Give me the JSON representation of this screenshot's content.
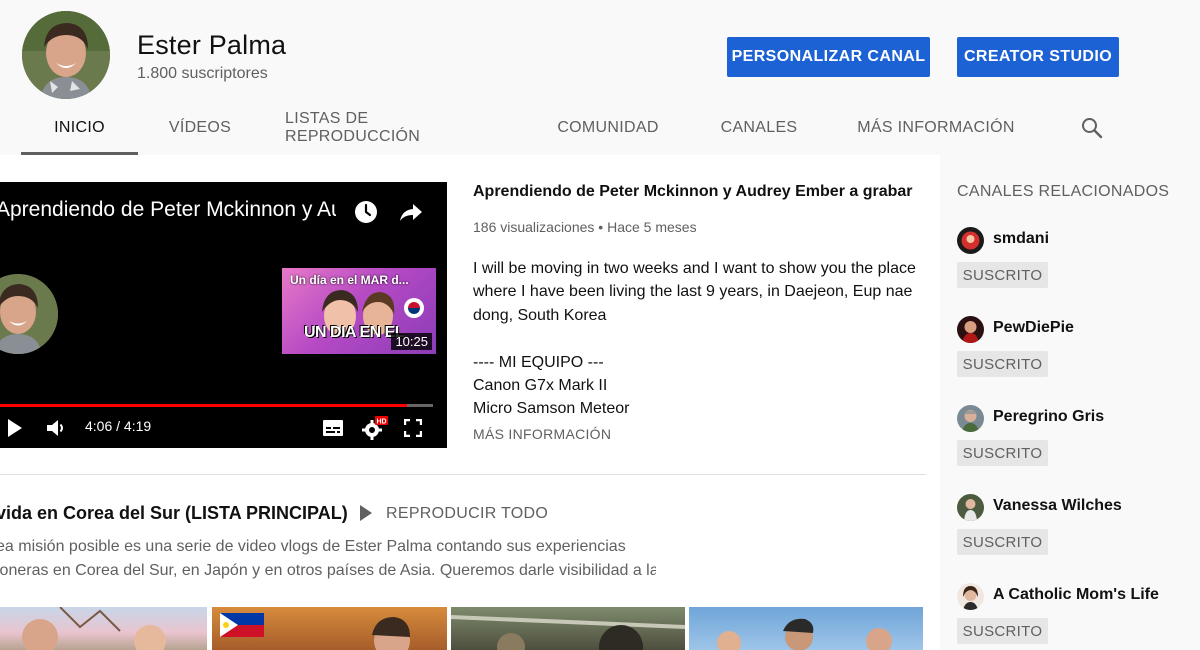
{
  "channel": {
    "name": "Ester Palma",
    "subscribers": "1.800 suscriptores",
    "customize_label": "PERSONALIZAR CANAL",
    "studio_label": "CREATOR STUDIO"
  },
  "tabs": [
    {
      "label": "INICIO",
      "active": true
    },
    {
      "label": "VÍDEOS"
    },
    {
      "label": "LISTAS DE REPRODUCCIÓN"
    },
    {
      "label": "COMUNIDAD"
    },
    {
      "label": "CANALES"
    },
    {
      "label": "MÁS INFORMACIÓN"
    }
  ],
  "player": {
    "title": "Aprendiendo de Peter Mckinnon y Au...",
    "endcard_title": "Un día en el MAR d...",
    "endcard_text": "UN DIA EN EL",
    "endcard_duration": "10:25",
    "time": "4:06 / 4:19",
    "progress": 0.94
  },
  "featured": {
    "title": "Aprendiendo de Peter Mckinnon y Audrey Ember a grabar un ...",
    "meta": "186 visualizaciones • Hace 5 meses",
    "description": [
      "I will be moving in two weeks and I want to show you the place",
      "where I have been living the last 9 years, in Daejeon, Eup nae",
      "dong, South Korea",
      "",
      "---- MI EQUIPO ---",
      "Canon G7x Mark II",
      "Micro Samson Meteor"
    ],
    "more_label": "MÁS INFORMACIÓN"
  },
  "playlist": {
    "title": "vida en Corea del Sur (LISTA PRINCIPAL)",
    "play_all": "REPRODUCIR TODO",
    "description": [
      "ea misión posible es una serie de video vlogs de Ester Palma contando sus experiencias",
      "ioneras en Corea del Sur, en Japón y en otros países de Asia. Queremos darle visibilidad a la"
    ]
  },
  "related": {
    "title": "CANALES RELACIONADOS",
    "button_label": "SUSCRITO",
    "channels": [
      {
        "name": "smdani",
        "color": "#c0392b"
      },
      {
        "name": "PewDiePie",
        "color": "#3a1f1f"
      },
      {
        "name": "Peregrino Gris",
        "color": "#6d7b8a"
      },
      {
        "name": "Vanessa Wilches",
        "color": "#4c5b3f"
      },
      {
        "name": "A Catholic Mom's Life",
        "color": "#a08070"
      }
    ]
  },
  "colors": {
    "accent": "#1c62d4",
    "progress": "#ff0000"
  }
}
